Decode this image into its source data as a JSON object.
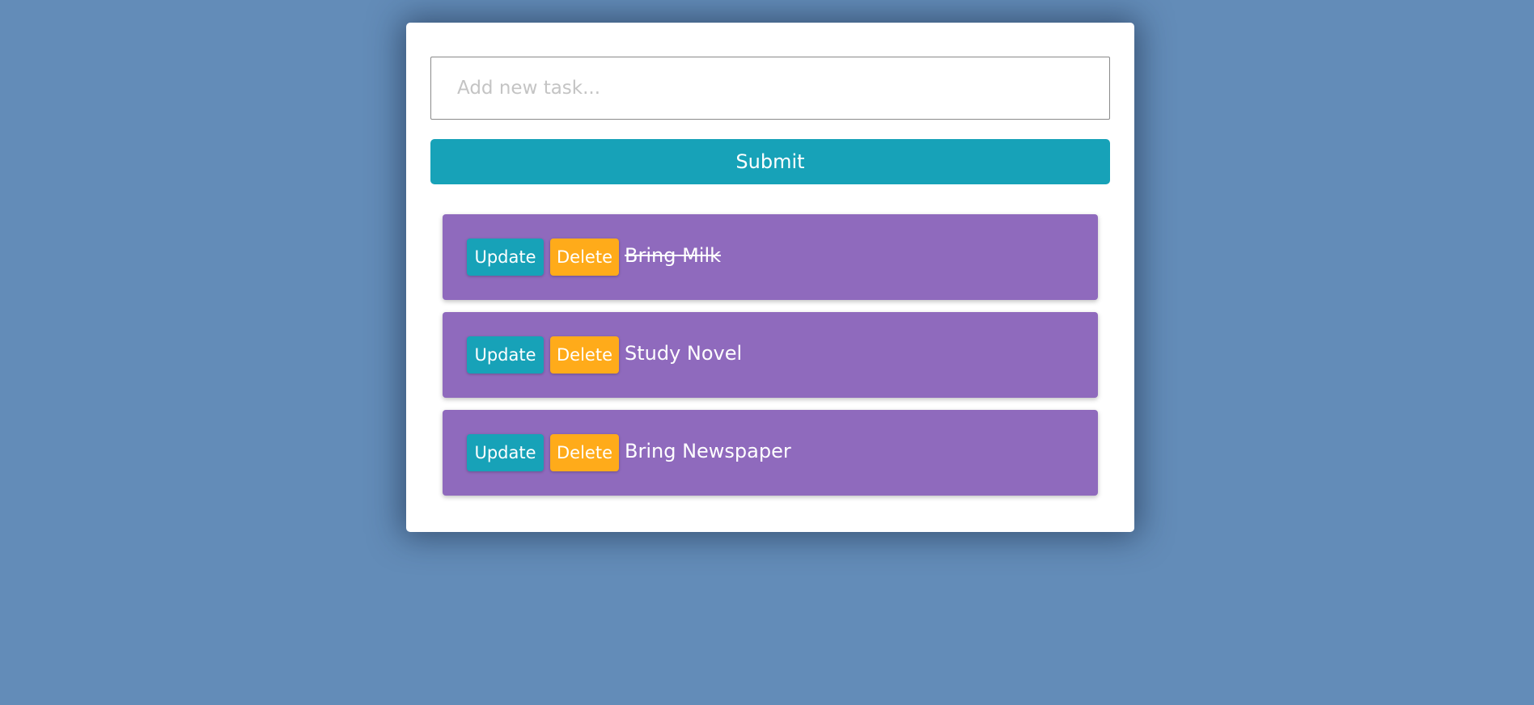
{
  "form": {
    "input_placeholder": "Add new task...",
    "input_value": "",
    "submit_label": "Submit"
  },
  "tasks": [
    {
      "text": "Bring Milk",
      "completed": true,
      "update_label": "Update",
      "delete_label": "Delete"
    },
    {
      "text": "Study Novel",
      "completed": false,
      "update_label": "Update",
      "delete_label": "Delete"
    },
    {
      "text": "Bring Newspaper",
      "completed": false,
      "update_label": "Update",
      "delete_label": "Delete"
    }
  ],
  "colors": {
    "background": "#638cb8",
    "card": "#ffffff",
    "primary": "#17a2b8",
    "warning": "#ffab1a",
    "task_item": "#8f6abd"
  }
}
